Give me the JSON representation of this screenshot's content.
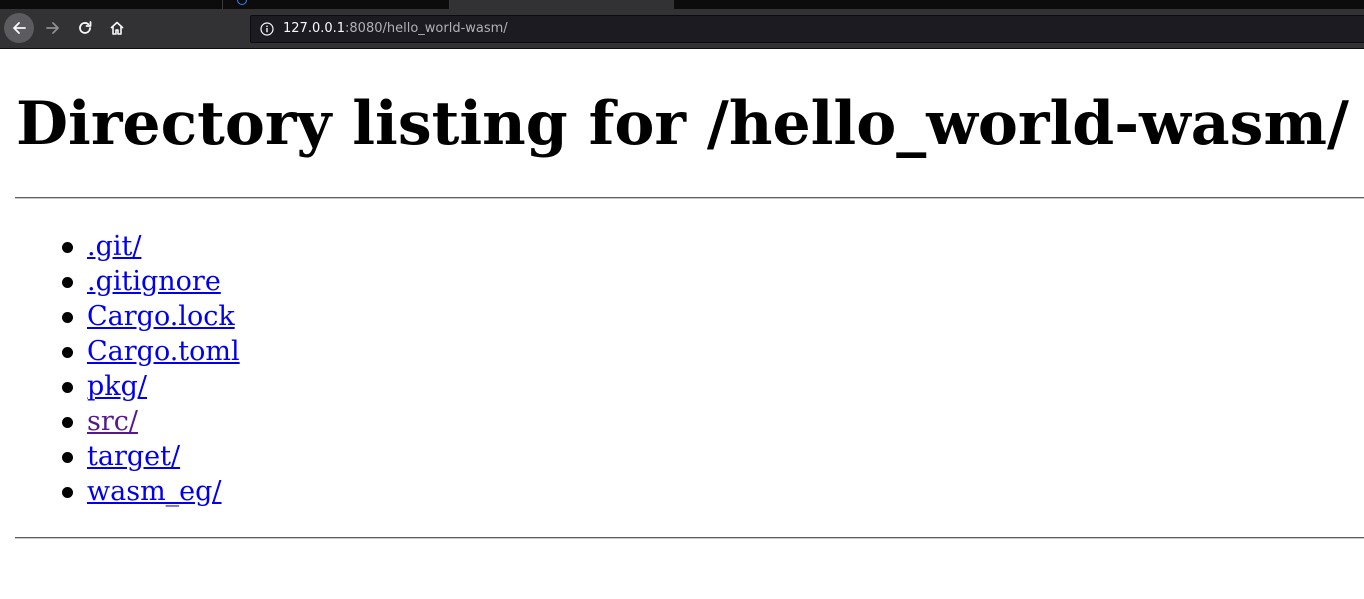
{
  "browser": {
    "url": {
      "host": "127.0.0.1",
      "rest": ":8080/hello_world-wasm/"
    },
    "icons": {
      "back": "arrow-left-icon",
      "forward": "arrow-right-icon",
      "reload": "reload-icon",
      "home": "home-icon",
      "info": "info-icon"
    }
  },
  "page": {
    "title": "Directory listing for /hello_world-wasm/",
    "entries": [
      {
        "label": ".git/",
        "visited": false
      },
      {
        "label": ".gitignore",
        "visited": false
      },
      {
        "label": "Cargo.lock",
        "visited": false
      },
      {
        "label": "Cargo.toml",
        "visited": false
      },
      {
        "label": "pkg/",
        "visited": false
      },
      {
        "label": "src/",
        "visited": true
      },
      {
        "label": "target/",
        "visited": false
      },
      {
        "label": "wasm_eg/",
        "visited": false
      }
    ],
    "colors": {
      "link": "#0000ee",
      "visited_link": "#551a8b"
    }
  }
}
